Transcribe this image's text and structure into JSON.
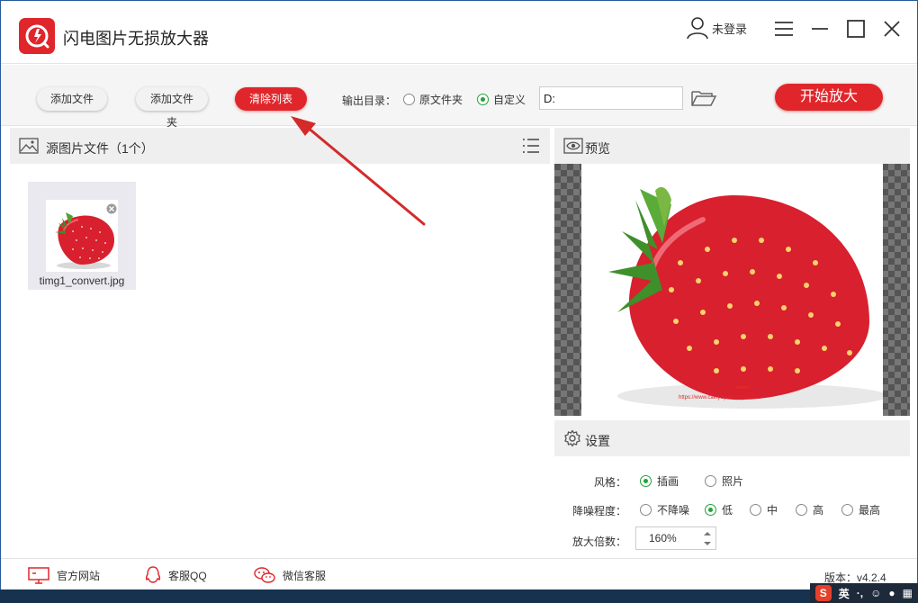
{
  "window": {
    "title": "闪电图片无损放大器",
    "login_label": "未登录"
  },
  "toolbar": {
    "add_file": "添加文件",
    "add_folder": "添加文件夹",
    "clear_list": "清除列表",
    "output_label": "输出目录：",
    "option_original": "原文件夹",
    "option_custom": "自定义",
    "output_selected": "自定义",
    "output_path": "D:",
    "start_button": "开始放大"
  },
  "source_panel": {
    "title": "源图片文件（1个）",
    "files": [
      {
        "name": "timg1_convert.jpg"
      }
    ]
  },
  "preview_panel": {
    "title": "预览",
    "watermark_url": "https://www.cainyeyef.cn/kjkonhou"
  },
  "settings_panel": {
    "title": "设置",
    "style_label": "风格：",
    "style_options": [
      "插画",
      "照片"
    ],
    "style_selected": "插画",
    "denoise_label": "降噪程度：",
    "denoise_options": [
      "不降噪",
      "低",
      "中",
      "高",
      "最高"
    ],
    "denoise_selected": "低",
    "scale_label": "放大倍数：",
    "scale_value": "160%"
  },
  "footer": {
    "website": "官方网站",
    "qq_support": "客服QQ",
    "wechat_support": "微信客服",
    "version": "版本：v4.2.4"
  },
  "taskbar": {
    "ime_language": "英"
  },
  "colors": {
    "brand_red": "#e0262b",
    "radio_green": "#21a33a",
    "panel_gray": "#efefef"
  },
  "icons": {
    "logo": "app-logo-icon",
    "user": "user-icon",
    "menu": "menu-icon",
    "minimize": "minimize-icon",
    "maximize": "maximize-icon",
    "close": "close-icon",
    "folder": "folder-open-icon",
    "image": "image-icon",
    "list": "list-icon",
    "eye": "eye-icon",
    "gear": "gear-icon",
    "monitor": "monitor-icon",
    "qq": "qq-icon",
    "wechat": "wechat-icon"
  }
}
